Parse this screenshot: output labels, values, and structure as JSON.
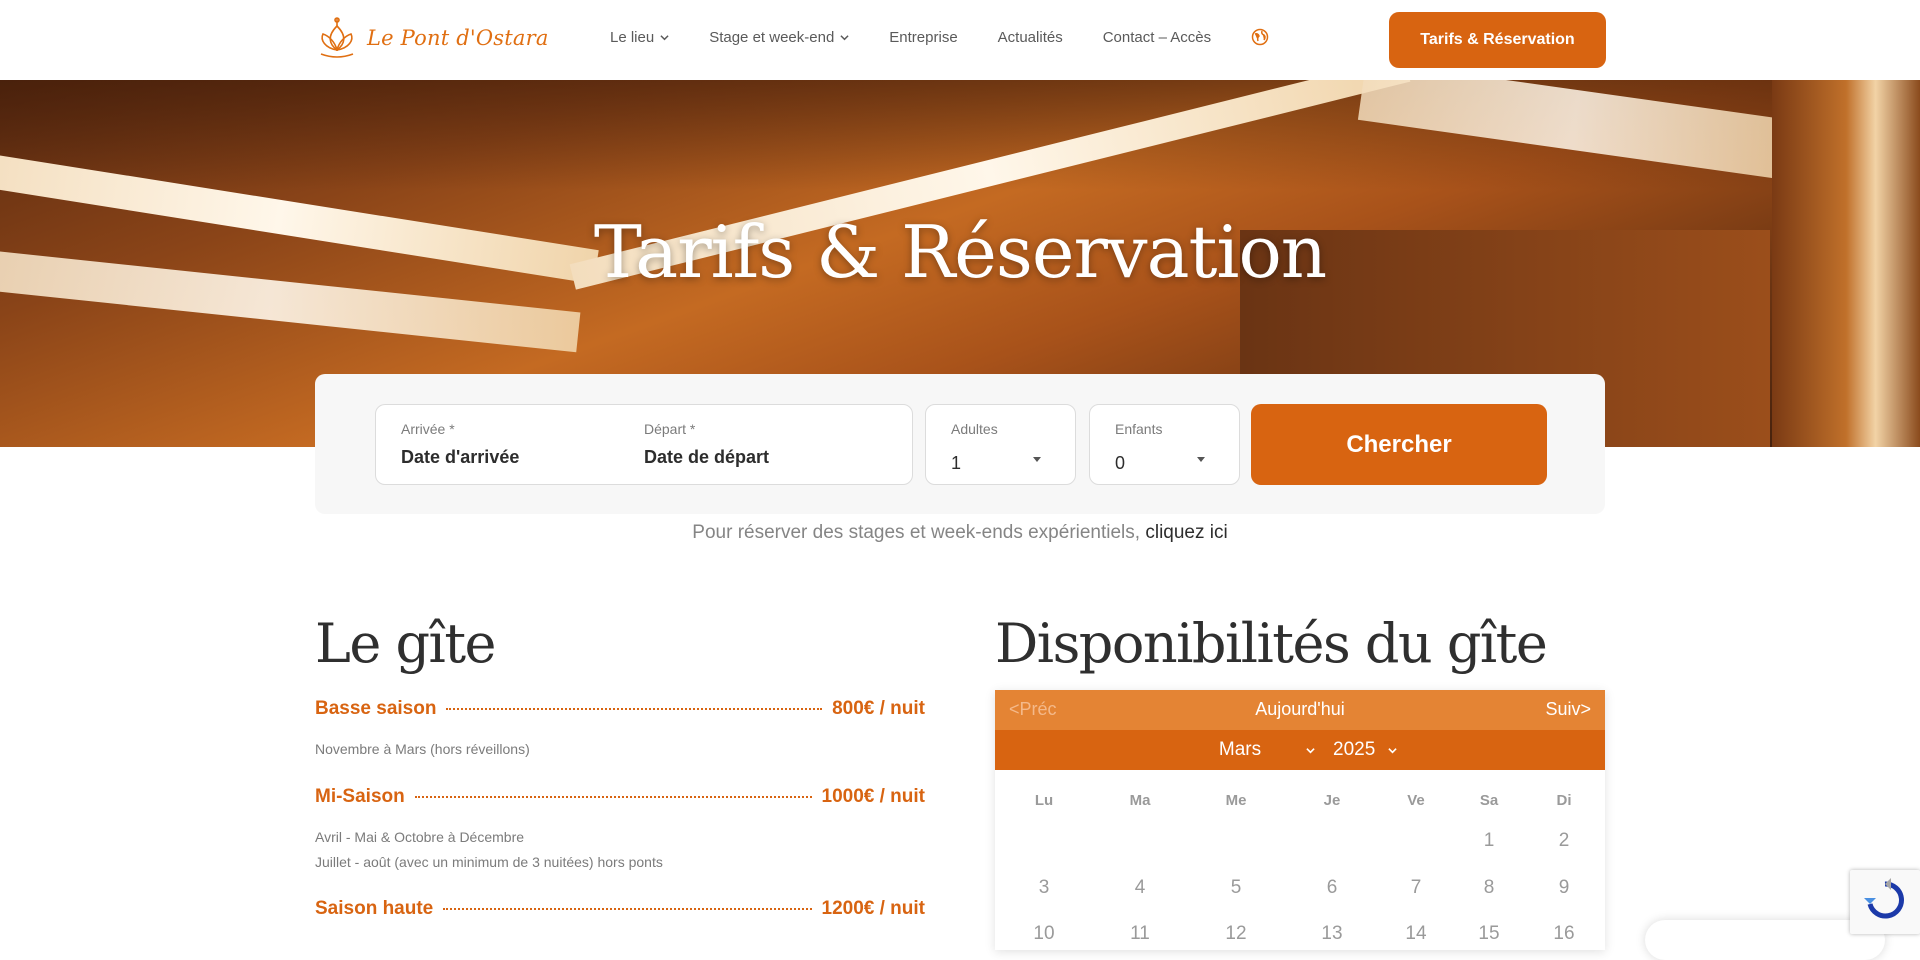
{
  "header": {
    "logo_text": "Le Pont d'Ostara",
    "nav": [
      {
        "label": "Le lieu",
        "has_dropdown": true
      },
      {
        "label": "Stage et week-end",
        "has_dropdown": true
      },
      {
        "label": "Entreprise",
        "has_dropdown": false
      },
      {
        "label": "Actualités",
        "has_dropdown": false
      },
      {
        "label": "Contact – Accès",
        "has_dropdown": false
      }
    ],
    "language_icon": "globe-icon",
    "cta_label": "Tarifs & Réservation"
  },
  "hero": {
    "title": "Tarifs & Réservation"
  },
  "booking": {
    "arrival_label": "Arrivée *",
    "arrival_placeholder": "Date d'arrivée",
    "departure_label": "Départ *",
    "departure_placeholder": "Date de départ",
    "adults_label": "Adultes",
    "adults_value": "1",
    "children_label": "Enfants",
    "children_value": "0",
    "search_label": "Chercher"
  },
  "note": {
    "text": "Pour réserver des stages et week-ends expérientiels,",
    "link": "cliquez ici"
  },
  "gite": {
    "title": "Le gîte",
    "prices": [
      {
        "name": "Basse saison",
        "value": "800€ / nuit",
        "desc": [
          "Novembre à Mars (hors réveillons)"
        ]
      },
      {
        "name": "Mi-Saison",
        "value": "1000€ / nuit",
        "desc": [
          "Avril - Mai & Octobre à Décembre",
          "Juillet - août (avec un minimum de 3 nuitées) hors ponts"
        ]
      },
      {
        "name": "Saison haute",
        "value": "1200€ / nuit",
        "desc": []
      }
    ]
  },
  "availability": {
    "title": "Disponibilités du gîte",
    "prev": "<Préc",
    "today": "Aujourd'hui",
    "next": "Suiv>",
    "month": "Mars",
    "year": "2025",
    "weekdays": [
      "Lu",
      "Ma",
      "Me",
      "Je",
      "Ve",
      "Sa",
      "Di"
    ],
    "weeks": [
      [
        "",
        "",
        "",
        "",
        "",
        "1",
        "2"
      ],
      [
        "3",
        "4",
        "5",
        "6",
        "7",
        "8",
        "9"
      ],
      [
        "10",
        "11",
        "12",
        "13",
        "14",
        "15",
        "16"
      ]
    ]
  },
  "colors": {
    "accent": "#d86411",
    "accent_light": "#e48434"
  }
}
